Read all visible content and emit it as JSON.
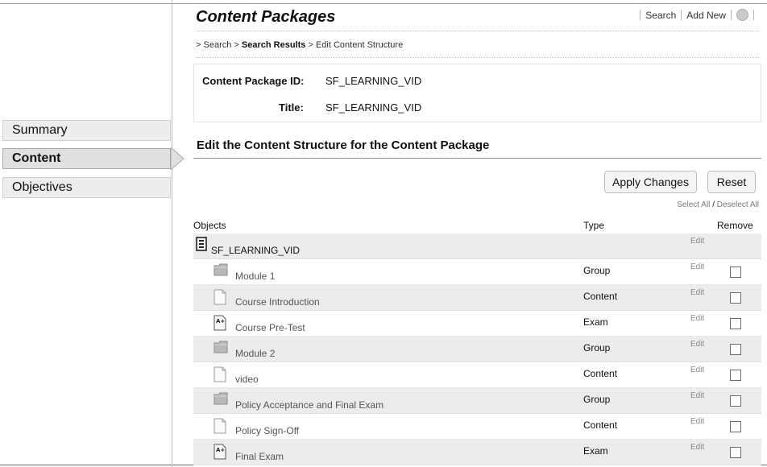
{
  "nav": {
    "items": [
      {
        "label": "Summary"
      },
      {
        "label": "Content"
      },
      {
        "label": "Objectives"
      }
    ]
  },
  "header": {
    "title": "Content Packages",
    "links": {
      "search": "Search",
      "add_new": "Add New"
    }
  },
  "breadcrumb": {
    "prefix": ">",
    "search": "Search",
    "sep1": ">",
    "results": "Search Results",
    "sep2": ">",
    "current": "Edit Content Structure"
  },
  "info": {
    "id_label": "Content Package ID:",
    "id_value": "SF_LEARNING_VID",
    "title_label": "Title:",
    "title_value": "SF_LEARNING_VID"
  },
  "section": {
    "title": "Edit the Content Structure for the Content Package"
  },
  "actions": {
    "apply": "Apply Changes",
    "reset": "Reset",
    "select_all": "Select All",
    "slash": "/",
    "deselect_all": "Deselect All"
  },
  "table": {
    "headers": {
      "objects": "Objects",
      "type": "Type",
      "remove": "Remove"
    },
    "root": {
      "name": "SF_LEARNING_VID",
      "edit": "Edit",
      "icon": "package-icon"
    },
    "rows": [
      {
        "name": "Module 1",
        "type": "Group",
        "edit": "Edit",
        "icon": "folder-icon"
      },
      {
        "name": "Course Introduction",
        "type": "Content",
        "edit": "Edit",
        "icon": "document-icon"
      },
      {
        "name": "Course Pre-Test",
        "type": "Exam",
        "edit": "Edit",
        "icon": "exam-icon"
      },
      {
        "name": "Module 2",
        "type": "Group",
        "edit": "Edit",
        "icon": "folder-icon"
      },
      {
        "name": "video",
        "type": "Content",
        "edit": "Edit",
        "icon": "document-icon"
      },
      {
        "name": "Policy Acceptance and Final Exam",
        "type": "Group",
        "edit": "Edit",
        "icon": "folder-icon"
      },
      {
        "name": "Policy Sign-Off",
        "type": "Content",
        "edit": "Edit",
        "icon": "document-icon"
      },
      {
        "name": "Final Exam",
        "type": "Exam",
        "edit": "Edit",
        "icon": "exam-icon"
      }
    ]
  }
}
